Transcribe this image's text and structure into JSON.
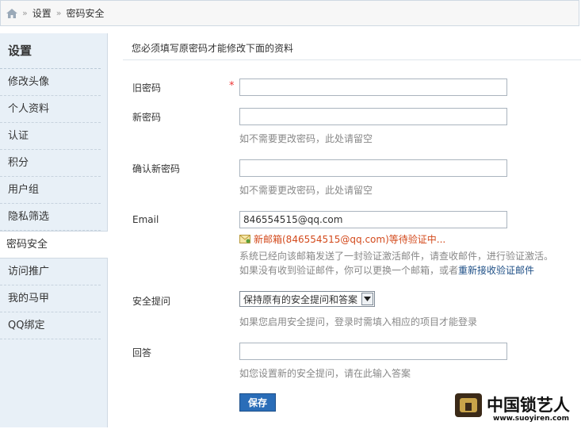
{
  "breadcrumb": {
    "items": [
      "设置",
      "密码安全"
    ]
  },
  "sidebar": {
    "title": "设置",
    "items": [
      {
        "label": "修改头像"
      },
      {
        "label": "个人资料"
      },
      {
        "label": "认证"
      },
      {
        "label": "积分"
      },
      {
        "label": "用户组"
      },
      {
        "label": "隐私筛选"
      },
      {
        "label": "密码安全"
      },
      {
        "label": "访问推广"
      },
      {
        "label": "我的马甲"
      },
      {
        "label": "QQ绑定"
      }
    ]
  },
  "form": {
    "notice": "您必须填写原密码才能修改下面的资料",
    "old_password": {
      "label": "旧密码",
      "required_mark": "*",
      "value": ""
    },
    "new_password": {
      "label": "新密码",
      "value": "",
      "hint": "如不需要更改密码，此处请留空"
    },
    "confirm_password": {
      "label": "确认新密码",
      "value": "",
      "hint": "如不需要更改密码，此处请留空"
    },
    "email": {
      "label": "Email",
      "value": "846554515@qq.com",
      "pending": "新邮箱(846554515@qq.com)等待验证中...",
      "hint_line1": "系统已经向该邮箱发送了一封验证激活邮件，请查收邮件，进行验证激活。",
      "hint_line2": "如果没有收到验证邮件，你可以更换一个邮箱，或者",
      "resend_link": "重新接收验证邮件"
    },
    "security_question": {
      "label": "安全提问",
      "selected": "保持原有的安全提问和答案",
      "hint": "如果您启用安全提问，登录时需填入相应的项目才能登录"
    },
    "answer": {
      "label": "回答",
      "value": "",
      "hint": "如您设置新的安全提问，请在此输入答案"
    },
    "save_label": "保存"
  },
  "watermark": {
    "text": "中国锁艺人",
    "url_text": "www.suoyiren.com"
  }
}
